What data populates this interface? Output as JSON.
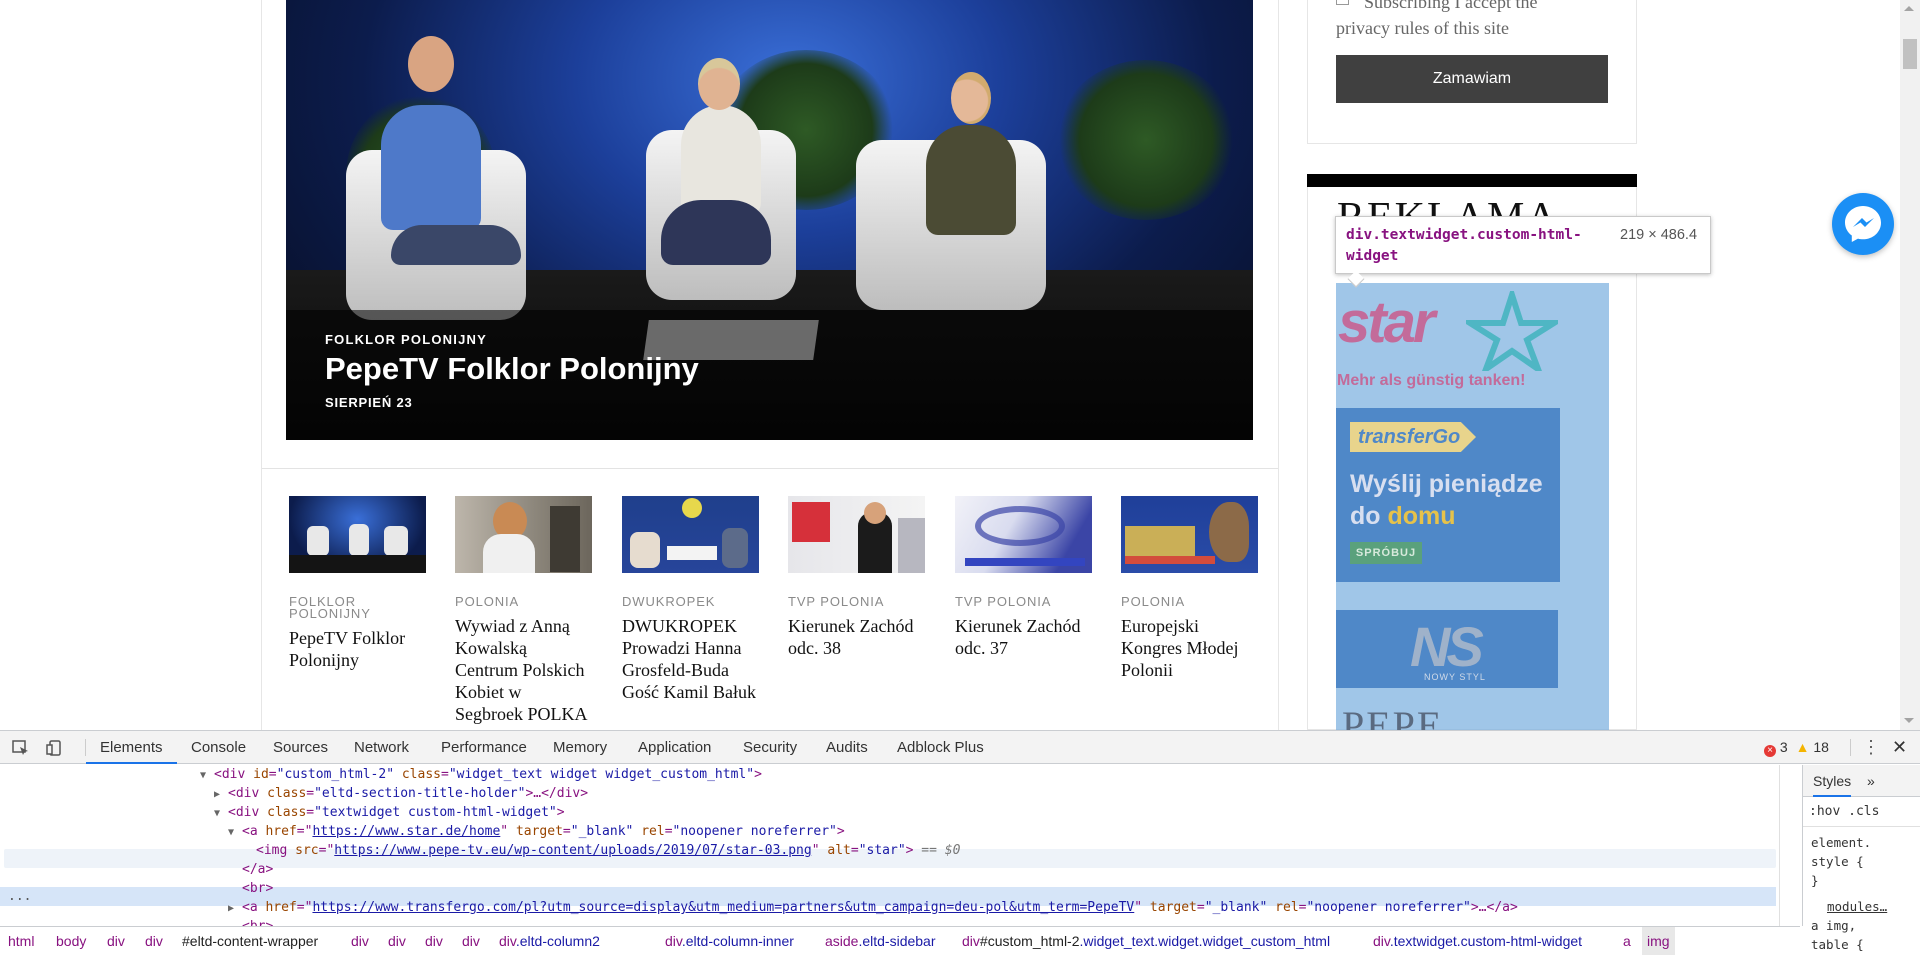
{
  "hero": {
    "category": "FOLKLOR POLONIJNY",
    "title": "PepeTV Folklor Polonijny",
    "date": "SIERPIEŃ 23"
  },
  "cards": [
    {
      "category": "FOLKLOR POLONIJNY",
      "title": "PepeTV Folklor Polonijny"
    },
    {
      "category": "POLONIA",
      "title": "Wywiad z Anną Kowalską Centrum Polskich Kobiet w Segbroek POLKA"
    },
    {
      "category": "DWUKROPEK",
      "title": "DWUKROPEK Prowadzi Hanna Grosfeld-Buda Gość Kamil Bałuk"
    },
    {
      "category": "TVP POLONIA",
      "title": "Kierunek Zachód odc. 38"
    },
    {
      "category": "TVP POLONIA",
      "title": "Kierunek Zachód odc. 37"
    },
    {
      "category": "POLONIA",
      "title": "Europejski Kongres Młodej Polonii"
    }
  ],
  "sidebar": {
    "privacy_line1": "Subscribing I accept the",
    "privacy_line2": "privacy rules of this site",
    "order_button": "Zamawiam",
    "ad_title": "REKLAMA",
    "star_word": "star",
    "star_tagline": "Mehr als günstig tanken!",
    "transfergo_logo": "transferGo",
    "transfergo_text1": "Wyślij pieniądze",
    "transfergo_text2a": "do ",
    "transfergo_text2b": "domu",
    "transfergo_button": "SPRÓBUJ",
    "ns_logo": "NS",
    "ns_sub": "NOWY STYL",
    "pepe_peek": "PEPE"
  },
  "tooltip": {
    "selector": "div.textwidget.custom-html-widget",
    "dimensions": "219 × 486.4"
  },
  "devtools": {
    "tabs": [
      "Elements",
      "Console",
      "Sources",
      "Network",
      "Performance",
      "Memory",
      "Application",
      "Security",
      "Audits",
      "Adblock Plus"
    ],
    "active_tab": "Elements",
    "errors": "3",
    "warnings": "18",
    "dom": {
      "l1_tag": "<div ",
      "l1_a1": "id",
      "l1_v1": "\"custom_html-2\"",
      "l1_a2": "class",
      "l1_v2": "\"widget_text widget widget_custom_html\"",
      "l1_end": ">",
      "l2_open": "<div ",
      "l2_a": "class",
      "l2_v": "\"eltd-section-title-holder\"",
      "l2_end": ">…</div>",
      "l3_open": "<div ",
      "l3_a": "class",
      "l3_v": "\"textwidget custom-html-widget\"",
      "l3_end": ">",
      "l4_open": "<a ",
      "l4_a1": "href",
      "l4_link": "https://www.star.de/home",
      "l4_a2": "target",
      "l4_v2": "\"_blank\"",
      "l4_a3": "rel",
      "l4_v3": "\"noopener noreferrer\"",
      "l4_end": ">",
      "l5_open": "<img ",
      "l5_a1": "src",
      "l5_link": "https://www.pepe-tv.eu/wp-content/uploads/2019/07/star-03.png",
      "l5_a2": "alt",
      "l5_v2": "\"star\"",
      "l5_end": ">",
      "l5_marker": " == $0",
      "l6": "</a>",
      "l7": "<br>",
      "l8_open": "<a ",
      "l8_a1": "href",
      "l8_link": "https://www.transfergo.com/pl?utm_source=display&utm_medium=partners&utm_campaign=deu-pol&utm_term=PepeTV",
      "l8_a2": "target",
      "l8_v2": "\"_blank\"",
      "l8_a3": "rel",
      "l8_v3": "\"noopener noreferrer\"",
      "l8_end": ">…</a>",
      "l9": "<br>",
      "ellipsis": "..."
    },
    "styles": {
      "tab": "Styles",
      "more": "»",
      "filter": ":hov .cls",
      "rule1": "element.",
      "rule2": "style {",
      "rule3": "}",
      "rule4": "modules…",
      "rule5": "a img,",
      "rule6": "table {"
    },
    "breadcrumbs": {
      "c1": "html",
      "c2": "body",
      "c3": "div",
      "c4": "div",
      "c5": "#eltd-content-wrapper",
      "c6": "div",
      "c7": "div",
      "c8": "div",
      "c9": "div",
      "c10_tag": "div",
      "c10_cls": ".eltd-column2",
      "c11_tag": "div",
      "c11_cls": ".eltd-column-inner",
      "c12_tag": "aside",
      "c12_cls": ".eltd-sidebar",
      "c13_tag": "div",
      "c13_id": "#custom_html-2",
      "c13_cls": ".widget_text.widget.widget_custom_html",
      "c14_tag": "div",
      "c14_cls": ".textwidget.custom-html-widget",
      "c15": "a",
      "c16": "img"
    }
  }
}
